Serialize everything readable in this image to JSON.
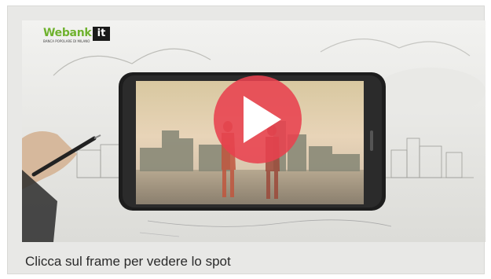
{
  "logo": {
    "word": "Webank",
    "suffix": "it",
    "tagline": "BANCA POPOLARE DI MILANO"
  },
  "video": {
    "play_button_color": "#e8414f"
  },
  "caption": "Clicca sul frame per vedere lo spot"
}
